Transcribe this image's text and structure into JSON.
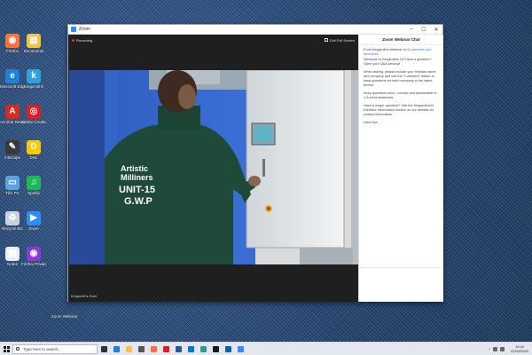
{
  "desktop": {
    "icons": [
      {
        "label": "Firefox",
        "color": "#ff7139",
        "glyph": "◉"
      },
      {
        "label": "Documents",
        "color": "#f6c244",
        "glyph": "▤"
      },
      {
        "label": "Microsoft Edge",
        "color": "#1f80d8",
        "glyph": "e"
      },
      {
        "label": "Kingsmiths",
        "color": "#2fa0e0",
        "glyph": "k"
      },
      {
        "label": "Acrobat Reader DC",
        "color": "#d42b1f",
        "glyph": "A"
      },
      {
        "label": "Adobe Creative Cloud",
        "color": "#da1f26",
        "glyph": "◎"
      },
      {
        "label": "Inkscape",
        "color": "#3a3a3a",
        "glyph": "✎"
      },
      {
        "label": "DHL",
        "color": "#fcc800",
        "glyph": "D"
      },
      {
        "label": "This PC",
        "color": "#5ba3e0",
        "glyph": "▭"
      },
      {
        "label": "Spotify",
        "color": "#1db954",
        "glyph": "♫"
      },
      {
        "label": "Recycle Bin",
        "color": "#c9d3dd",
        "glyph": "♻"
      },
      {
        "label": "Zoom",
        "color": "#2d8cff",
        "glyph": "▶"
      },
      {
        "label": "Notes",
        "color": "#e9eef3",
        "glyph": "▤"
      },
      {
        "label": "Firefox Private",
        "color": "#8a3ad9",
        "glyph": "◉"
      }
    ],
    "bottom_label": "Zoom Webinar"
  },
  "window": {
    "title": "Zoom",
    "controls": {
      "minimize": "–",
      "maximize": "☐",
      "close": "✕"
    }
  },
  "video": {
    "recording_label": "Recording",
    "exit_fullscreen_label": "Exit Full Screen",
    "speaker_name": "Kingsmiths Host",
    "shirt_lines": [
      "Artistic",
      "Milliners",
      "UNIT-15",
      "G.W.P"
    ]
  },
  "chat": {
    "title": "Zoom Webinar Chat",
    "from_prefix": "From Kingsmiths Webinar to",
    "from_target": "All panelists and attendees",
    "paragraphs": [
      "Welcome to Kingsmiths 24! Have a question? Open your Q&A window!",
      "When asking, please include your first/last name and company and use the \"Comment\" button to keep questions for each company in the same thread.",
      "Keep questions short, concise and answerable in 1-3 short sentences.",
      "Have a longer question? Visit the Kingsmiths24 Exhibitor Information section on our website for contact information.",
      "Have fun!"
    ]
  },
  "taskbar": {
    "search_placeholder": "Type here to search",
    "apps": [
      {
        "name": "task-view",
        "color": "#333333"
      },
      {
        "name": "edge",
        "color": "#1f80d8"
      },
      {
        "name": "file-explorer",
        "color": "#f6c244"
      },
      {
        "name": "store",
        "color": "#555555"
      },
      {
        "name": "firefox",
        "color": "#ff7139"
      },
      {
        "name": "creative-cloud",
        "color": "#da1f26"
      },
      {
        "name": "word",
        "color": "#2b579a"
      },
      {
        "name": "outlook",
        "color": "#0078d4"
      },
      {
        "name": "photos",
        "color": "#2a9d8f"
      },
      {
        "name": "notes",
        "color": "#1a1a1a"
      },
      {
        "name": "mail",
        "color": "#0063b1"
      },
      {
        "name": "zoom",
        "color": "#2d8cff"
      }
    ],
    "tray_arrow": "^",
    "time": "12:24",
    "date": "22/04/2020"
  }
}
